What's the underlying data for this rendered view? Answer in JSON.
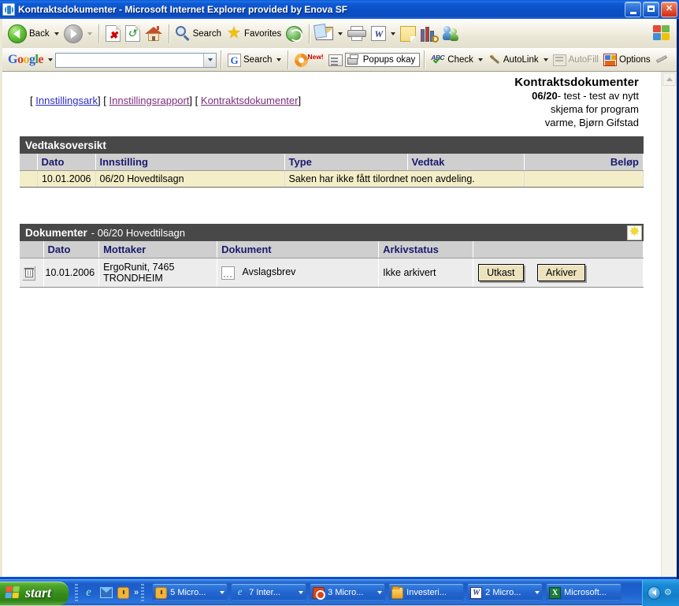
{
  "window": {
    "title": "Kontraktsdokumenter - Microsoft Internet Explorer provided by Enova SF",
    "minimize_label": "_",
    "maximize_label": "□",
    "close_label": "✕"
  },
  "toolbar": {
    "back_label": "Back",
    "search_label": "Search",
    "favorites_label": "Favorites"
  },
  "google_bar": {
    "logo": {
      "g1": "G",
      "o1": "o",
      "o2": "o",
      "g2": "g",
      "l": "l",
      "e": "e"
    },
    "search_value": "",
    "search_label": "Search",
    "new_badge": "New!",
    "popups_label": "Popups okay",
    "check_label": "Check",
    "autolink_label": "AutoLink",
    "autofill_label": "AutoFill",
    "options_label": "Options"
  },
  "page": {
    "links": [
      {
        "label": "Innstillingsark",
        "state": "unvisited"
      },
      {
        "label": "Innstillingsrapport",
        "state": "visited"
      },
      {
        "label": "Kontraktsdokumenter",
        "state": "visited"
      }
    ],
    "link_open": "[",
    "link_close": "]",
    "header": {
      "title": "Kontraktsdokumenter",
      "case_number": "06/20",
      "line2_rest": "- test - test av nytt",
      "line3": "skjema for program",
      "line4": "varme, Bjørn Gifstad"
    },
    "vedtak_section": {
      "band_title": "Vedtaksoversikt",
      "columns": [
        "",
        "Dato",
        "Innstilling",
        "Type",
        "Vedtak",
        "Beløp"
      ],
      "rows": [
        {
          "dato": "10.01.2006",
          "innstilling": "06/20 Hovedtilsagn",
          "type": "Saken har ikke fått tilordnet noen avdeling.",
          "vedtak": "",
          "belop": ""
        }
      ]
    },
    "dokumenter_section": {
      "band_title": "Dokumenter",
      "band_subtitle": "- 06/20 Hovedtilsagn",
      "band_icon": "sun-starburst-icon",
      "columns": [
        "",
        "Dato",
        "Mottaker",
        "Dokument",
        "Arkivstatus",
        ""
      ],
      "rows": [
        {
          "delete_icon": "trash-icon",
          "dato": "10.01.2006",
          "mottaker_line1": "ErgoRunit, 7465",
          "mottaker_line2": "TRONDHEIM",
          "doc_icon": "document-icon",
          "dokument": "Avslagsbrev",
          "arkivstatus": "Ikke arkivert",
          "buttons": [
            "Utkast",
            "Arkiver"
          ]
        }
      ]
    }
  },
  "taskbar": {
    "start_label": "start",
    "quicklaunch_more": "»",
    "tasks": [
      {
        "label": "5 Micro...",
        "icon": "outlook-icon",
        "has_caret": true
      },
      {
        "label": "7 Inter...",
        "icon": "ie-icon",
        "has_caret": true
      },
      {
        "label": "3 Micro...",
        "icon": "access-icon",
        "has_caret": true
      },
      {
        "label": "Investeri...",
        "icon": "folder-icon",
        "has_caret": false
      },
      {
        "label": "2 Micro...",
        "icon": "word-icon",
        "has_caret": true
      },
      {
        "label": "Microsoft...",
        "icon": "excel-icon",
        "has_caret": false
      }
    ]
  }
}
